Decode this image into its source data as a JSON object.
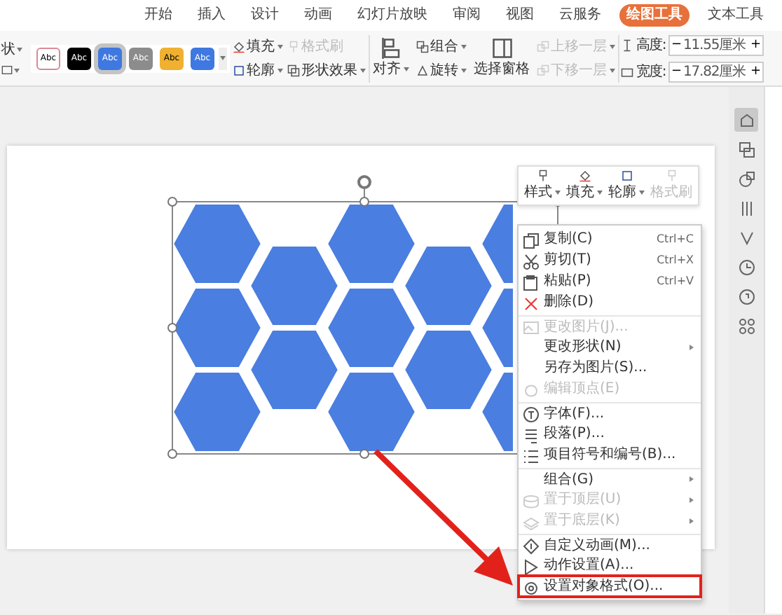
{
  "tabs": [
    {
      "label": "开始",
      "selected": false
    },
    {
      "label": "插入",
      "selected": false
    },
    {
      "label": "设计",
      "selected": false
    },
    {
      "label": "动画",
      "selected": false
    },
    {
      "label": "幻灯片放映",
      "selected": false
    },
    {
      "label": "审阅",
      "selected": false
    },
    {
      "label": "视图",
      "selected": false
    },
    {
      "label": "云服务",
      "selected": false
    },
    {
      "label": "绘图工具",
      "selected": true
    },
    {
      "label": "文本工具",
      "selected": false
    }
  ],
  "shape_menu": {
    "label": "状"
  },
  "style_swatches": [
    {
      "label": "Abc",
      "color": "#ffffff",
      "selected": false
    },
    {
      "label": "Abc",
      "color": "#000000",
      "selected": false
    },
    {
      "label": "Abc",
      "color": "#3f78e0",
      "selected": true
    },
    {
      "label": "Abc",
      "color": "#8c8c8c",
      "selected": false
    },
    {
      "label": "Abc",
      "color": "#f0b030",
      "selected": false
    },
    {
      "label": "Abc",
      "color": "#3f78e0",
      "selected": false
    }
  ],
  "fill_tools": [
    {
      "label": "填充",
      "dropdown": true,
      "disabled": false
    },
    {
      "label": "格式刷",
      "dropdown": false,
      "disabled": true
    },
    {
      "label": "轮廓",
      "dropdown": true,
      "disabled": false
    },
    {
      "label": "形状效果",
      "dropdown": true,
      "disabled": false
    }
  ],
  "arrange_tools": [
    {
      "label": "对齐",
      "kind": "large",
      "dropdown": true,
      "disabled": false
    },
    {
      "label": "组合",
      "kind": "small",
      "dropdown": true,
      "disabled": false
    },
    {
      "label": "旋转",
      "kind": "small",
      "dropdown": true,
      "disabled": false
    },
    {
      "label": "选择窗格",
      "kind": "large",
      "dropdown": false,
      "disabled": false
    },
    {
      "label": "上移一层",
      "kind": "small",
      "dropdown": true,
      "disabled": true
    },
    {
      "label": "下移一层",
      "kind": "small",
      "dropdown": true,
      "disabled": true
    }
  ],
  "size_fields": [
    {
      "label": "高度:",
      "value": "11.55厘米",
      "minus": "−",
      "plus": "+"
    },
    {
      "label": "宽度:",
      "value": "17.82厘米",
      "minus": "−",
      "plus": "+"
    }
  ],
  "mini_toolbar": [
    {
      "label": "样式",
      "dropdown": true,
      "disabled": false
    },
    {
      "label": "填充",
      "dropdown": true,
      "disabled": false
    },
    {
      "label": "轮廓",
      "dropdown": true,
      "disabled": false
    },
    {
      "label": "格式刷",
      "dropdown": false,
      "disabled": true
    }
  ],
  "shape": {
    "selected": true
  },
  "context_menu": [
    {
      "label": "复制(C)",
      "shortcut": "Ctrl+C",
      "submenu": false,
      "disabled": false,
      "separator_before": false,
      "highlighted": false
    },
    {
      "label": "剪切(T)",
      "shortcut": "Ctrl+X",
      "submenu": false,
      "disabled": false,
      "separator_before": false,
      "highlighted": false
    },
    {
      "label": "粘贴(P)",
      "shortcut": "Ctrl+V",
      "submenu": false,
      "disabled": false,
      "separator_before": false,
      "highlighted": false
    },
    {
      "label": "删除(D)",
      "submenu": false,
      "disabled": false,
      "separator_before": false,
      "highlighted": false
    },
    {
      "label": "更改图片(J)...",
      "submenu": false,
      "disabled": true,
      "separator_before": true,
      "highlighted": false
    },
    {
      "label": "更改形状(N)",
      "submenu": true,
      "disabled": false,
      "separator_before": false,
      "highlighted": false
    },
    {
      "label": "另存为图片(S)...",
      "submenu": false,
      "disabled": false,
      "separator_before": false,
      "highlighted": false
    },
    {
      "label": "编辑顶点(E)",
      "submenu": false,
      "disabled": true,
      "separator_before": false,
      "highlighted": false
    },
    {
      "label": "字体(F)...",
      "submenu": false,
      "disabled": false,
      "separator_before": true,
      "highlighted": false
    },
    {
      "label": "段落(P)...",
      "submenu": false,
      "disabled": false,
      "separator_before": false,
      "highlighted": false
    },
    {
      "label": "项目符号和编号(B)...",
      "submenu": false,
      "disabled": false,
      "separator_before": false,
      "highlighted": false
    },
    {
      "label": "组合(G)",
      "submenu": true,
      "disabled": false,
      "separator_before": true,
      "highlighted": false
    },
    {
      "label": "置于顶层(U)",
      "submenu": true,
      "disabled": true,
      "separator_before": false,
      "highlighted": false
    },
    {
      "label": "置于底层(K)",
      "submenu": true,
      "disabled": true,
      "separator_before": false,
      "highlighted": false
    },
    {
      "label": "自定义动画(M)...",
      "submenu": false,
      "disabled": false,
      "separator_before": true,
      "highlighted": false
    },
    {
      "label": "动作设置(A)...",
      "submenu": false,
      "disabled": false,
      "separator_before": false,
      "highlighted": false
    },
    {
      "label": "设置对象格式(O)...",
      "submenu": false,
      "disabled": false,
      "separator_before": false,
      "highlighted": true
    }
  ],
  "sidebar_icons": [
    {
      "selected": true
    },
    {
      "selected": false
    },
    {
      "selected": false
    },
    {
      "selected": false
    },
    {
      "selected": false
    },
    {
      "selected": false
    },
    {
      "selected": false
    },
    {
      "selected": false
    }
  ]
}
